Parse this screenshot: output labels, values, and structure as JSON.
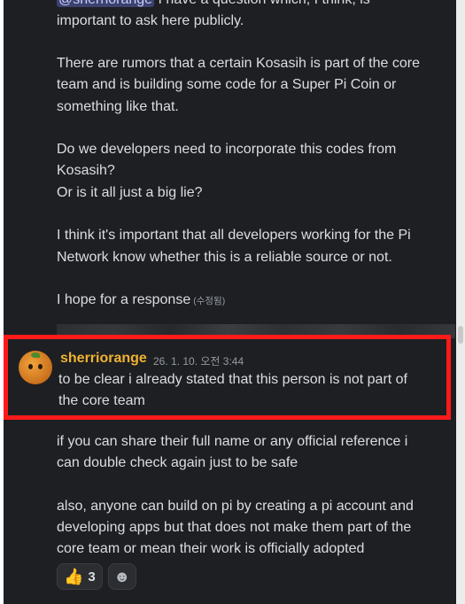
{
  "messages": {
    "first": {
      "mention": "@sherriorange",
      "line0_rest": " I have a question which, I think, is",
      "line1": "important to ask here publicly.",
      "p2_l1": "There are rumors that a certain Kosasih is part of the core",
      "p2_l2": "team and is building some code for a Super Pi Coin or",
      "p2_l3": "something like that.",
      "p3_l1": "Do we developers need to incorporate this codes from",
      "p3_l2": "Kosasih?",
      "p3_l3": "Or is it all just a big lie?",
      "p4_l1": "I think it's important that all developers working for the Pi",
      "p4_l2": "Network know whether this is a reliable source or not.",
      "p5": "I hope for a response",
      "edited": "(수정됨)"
    },
    "reply": {
      "author": "sherriorange",
      "timestamp": "26. 1. 10. 오전 3:44",
      "l1": "to be clear i already stated that this person is not part of",
      "l2": "the core team",
      "p2_l1": "if you can share their full name or any official reference i",
      "p2_l2": "can double check again just to be safe",
      "p3_l1": "also, anyone can build on pi by creating a pi account and",
      "p3_l2": "developing apps but that does not make them part of the",
      "p3_l3": "core team or mean their work is officially adopted"
    }
  },
  "reactions": [
    {
      "emoji": "👍",
      "count": "3",
      "icon": "thumbs-up-icon"
    },
    {
      "emoji": "☻",
      "icon": "add-reaction-icon"
    }
  ]
}
